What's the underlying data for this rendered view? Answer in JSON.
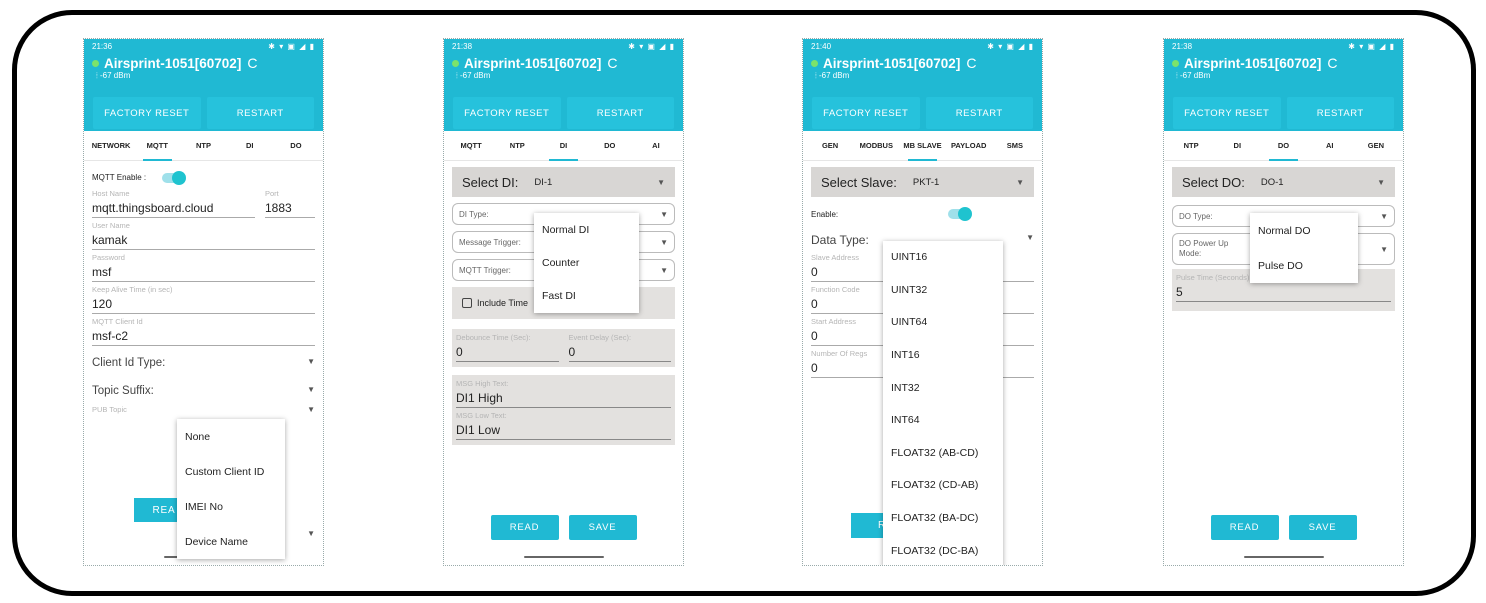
{
  "common": {
    "device_name": "Airsprint-1051[60702]",
    "signal": "-67 dBm",
    "factory_reset": "FACTORY RESET",
    "restart": "RESTART",
    "read": "READ",
    "save": "SAVE",
    "refresh_glyph": "C",
    "status_icons": "✱ ▾ ▣ ◢ ▮",
    "accent": "#20b9d3"
  },
  "phone1": {
    "time": "21:36",
    "tabs": [
      "NETWORK",
      "MQTT",
      "NTP",
      "DI",
      "DO"
    ],
    "active_tab": "MQTT",
    "mqtt_enable_label": "MQTT Enable :",
    "host_label": "Host Name",
    "host_value": "mqtt.thingsboard.cloud",
    "port_label": "Port",
    "port_value": "1883",
    "user_label": "User Name",
    "user_value": "kamak",
    "password_label": "Password",
    "password_value": "msf",
    "keepalive_label": "Keep Alive Time (in sec)",
    "keepalive_value": "120",
    "client_id_label": "MQTT Client Id",
    "client_id_value": "msf-c2",
    "client_id_type_label": "Client Id Type:",
    "topic_suffix_label": "Topic Suffix:",
    "pub_topic_label": "PUB Topic",
    "read_partial": "REA",
    "menu": [
      "None",
      "Custom Client ID",
      "IMEI No",
      "Device Name"
    ]
  },
  "phone2": {
    "time": "21:38",
    "tabs": [
      "MQTT",
      "NTP",
      "DI",
      "DO",
      "AI"
    ],
    "active_tab": "DI",
    "select_label": "Select DI:",
    "select_value": "DI-1",
    "di_type_label": "DI Type:",
    "message_trigger_label": "Message Trigger:",
    "mqtt_trigger_label": "MQTT Trigger:",
    "include_time_label": "Include Time",
    "debounce_label": "Debounce Time (Sec):",
    "debounce_value": "0",
    "event_delay_label": "Event Delay (Sec):",
    "event_delay_value": "0",
    "msg_high_label": "MSG High Text:",
    "msg_high_value": "DI1 High",
    "msg_low_label": "MSG Low Text:",
    "msg_low_value": "DI1 Low",
    "menu": [
      "Normal DI",
      "Counter",
      "Fast DI"
    ]
  },
  "phone3": {
    "time": "21:40",
    "tabs": [
      "GEN",
      "MODBUS",
      "MB SLAVE",
      "PAYLOAD",
      "SMS"
    ],
    "active_tab": "MB SLAVE",
    "select_label": "Select Slave:",
    "select_value": "PKT-1",
    "enable_label": "Enable:",
    "data_type_label": "Data Type:",
    "slave_address_label": "Slave Address",
    "slave_address_value": "0",
    "function_code_label": "Function Code",
    "function_code_value": "0",
    "start_address_label": "Start Address",
    "start_address_value": "0",
    "num_regs_label": "Number Of Regs",
    "num_regs_value": "0",
    "read_partial": "RE",
    "menu": [
      "UINT16",
      "UINT32",
      "UINT64",
      "INT16",
      "INT32",
      "INT64",
      "FLOAT32 (AB-CD)",
      "FLOAT32 (CD-AB)",
      "FLOAT32 (BA-DC)",
      "FLOAT32 (DC-BA)"
    ]
  },
  "phone4": {
    "time": "21:38",
    "tabs": [
      "NTP",
      "DI",
      "DO",
      "AI",
      "GEN"
    ],
    "active_tab": "DO",
    "select_label": "Select DO:",
    "select_value": "DO-1",
    "do_type_label": "DO Type:",
    "power_up_label": "DO Power Up Mode:",
    "pulse_time_label": "Pulse Time (Seconds)",
    "pulse_time_value": "5",
    "menu": [
      "Normal DO",
      "Pulse DO"
    ]
  }
}
